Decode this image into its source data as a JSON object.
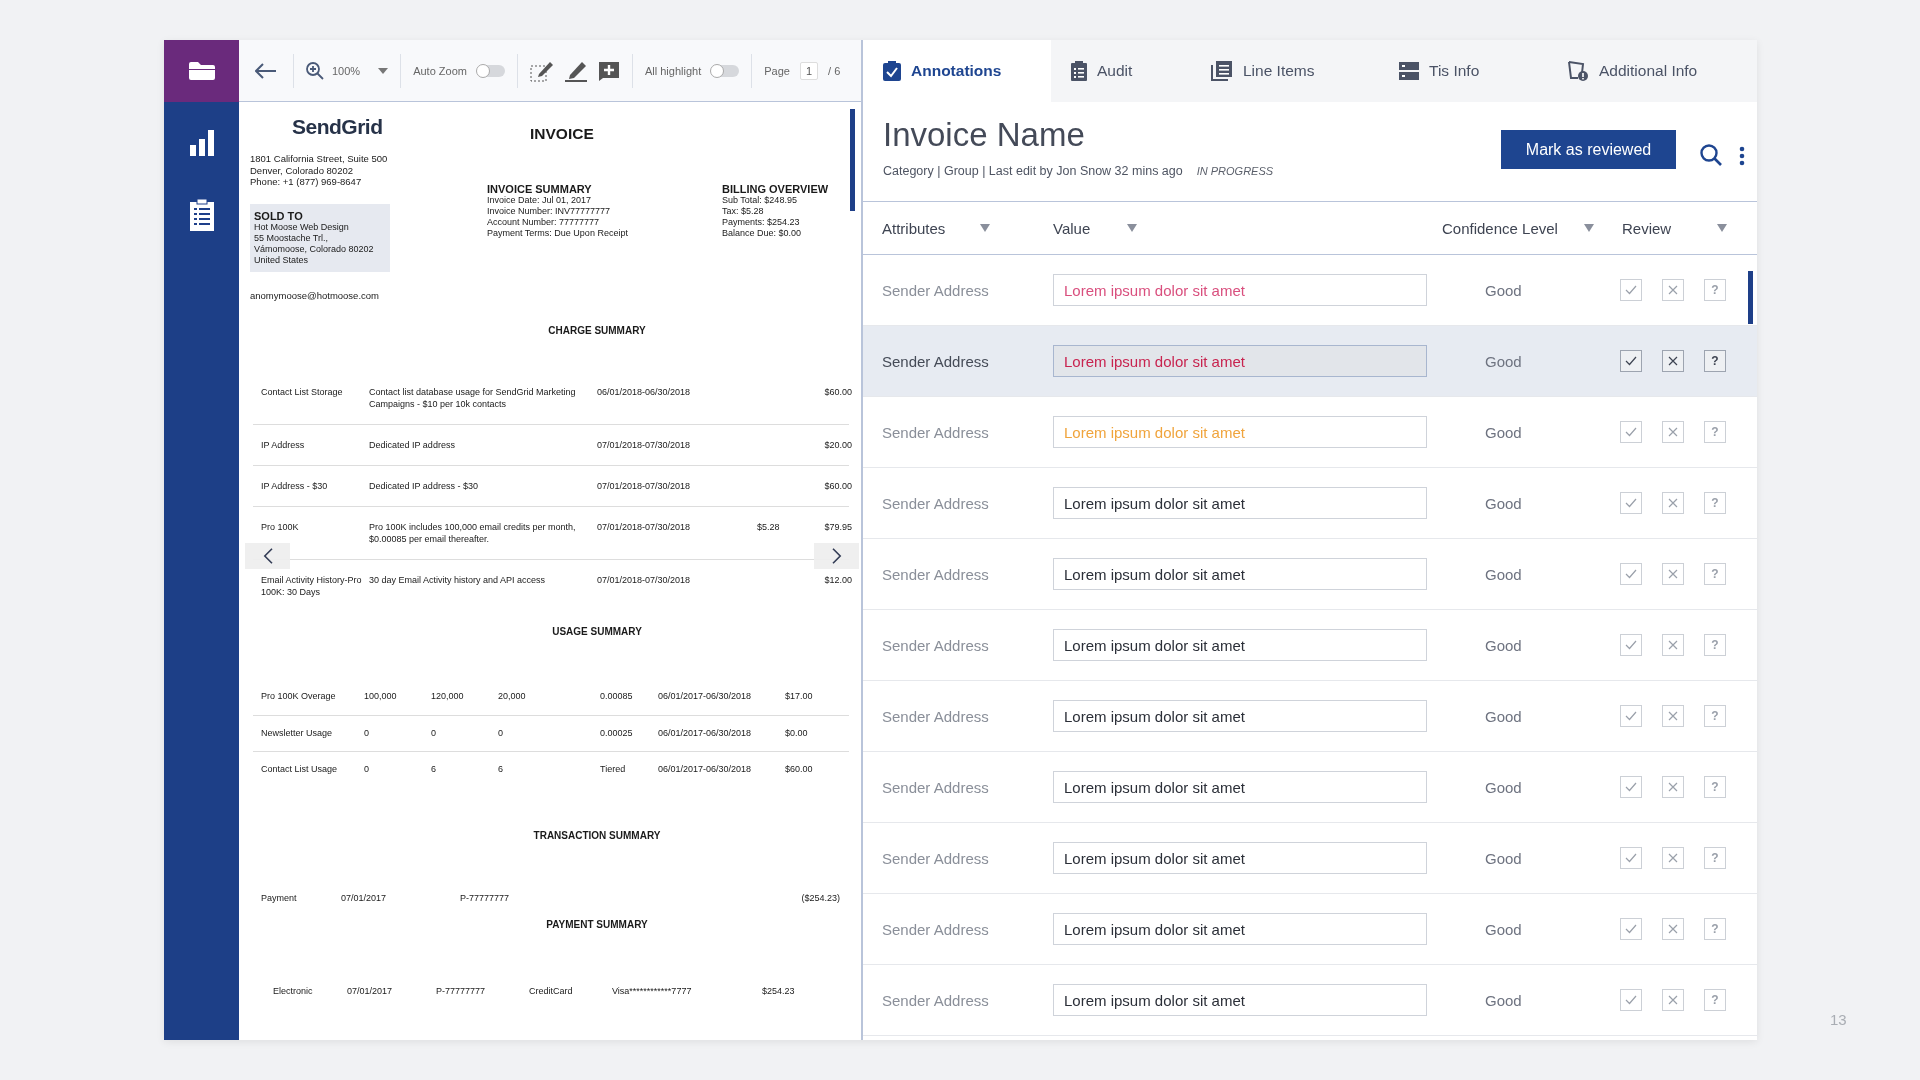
{
  "sidebar": {
    "items": [
      {
        "selected": true
      },
      {
        "selected": false
      },
      {
        "selected": false
      }
    ]
  },
  "toolbar": {
    "zoom": "100%",
    "auto_zoom": {
      "label": "Auto Zoom",
      "on": false
    },
    "all_highlight": {
      "label": "All highlight",
      "on": false
    },
    "page": {
      "label": "Page",
      "value": "1",
      "total": "/ 6"
    }
  },
  "document": {
    "logo": "SendGrid",
    "title": "INVOICE",
    "address": [
      "1801 California Street, Suite 500",
      "Denver, Colorado 80202",
      "Phone: +1 (877) 969-8647"
    ],
    "sold_to": {
      "heading": "SOLD TO",
      "lines": [
        "Hot Moose Web Design",
        "55 Moostache Trl.,",
        "Vámomoose, Colorado 80202",
        "United States"
      ]
    },
    "email": "anomymoose@hotmoose.com",
    "invoice_summary": {
      "heading": "INVOICE SUMMARY",
      "lines": [
        "Invoice Date: Jul 01, 2017",
        "Invoice Number: INV77777777",
        "Account Number: 77777777",
        "Payment Terms: Due Upon Receipt"
      ]
    },
    "billing_overview": {
      "heading": "BILLING OVERVIEW",
      "lines": [
        "Sub Total: $248.95",
        "Tax: $5.28",
        "Payments: $254.23",
        "Balance Due: $0.00"
      ]
    },
    "charge_summary": {
      "heading": "CHARGE SUMMARY",
      "rows": [
        {
          "item": "Contact List Storage",
          "description": "Contact list database usage for SendGrid Marketing Campaigns - $10 per 10k contacts",
          "period": "06/01/2018-06/30/2018",
          "amount": "$60.00"
        },
        {
          "item": "IP Address",
          "description": "Dedicated IP address",
          "period": "07/01/2018-07/30/2018",
          "amount": "$20.00"
        },
        {
          "item": "IP Address - $30",
          "description": "Dedicated IP address  - $30",
          "period": "07/01/2018-07/30/2018",
          "amount": "$60.00"
        },
        {
          "item": "Pro 100K",
          "description": "Pro 100K includes 100,000 email credits per month, $0.00085 per email thereafter.",
          "period": "07/01/2018-07/30/2018",
          "tax": "$5.28",
          "amount": "$79.95"
        },
        {
          "item": "Email Activity History-Pro 100K: 30 Days",
          "description": "30 day Email Activity history and API access",
          "period": "07/01/2018-07/30/2018",
          "amount": "$12.00"
        }
      ]
    },
    "usage_summary": {
      "heading": "USAGE SUMMARY",
      "rows": [
        [
          "Pro 100K Overage",
          "100,000",
          "120,000",
          "20,000",
          "0.00085",
          "06/01/2017-06/30/2018",
          "$17.00"
        ],
        [
          "Newsletter Usage",
          "0",
          "0",
          "0",
          "0.00025",
          "06/01/2017-06/30/2018",
          "$0.00"
        ],
        [
          "Contact List Usage",
          "0",
          "6",
          "6",
          "Tiered",
          "06/01/2017-06/30/2018",
          "$60.00"
        ]
      ]
    },
    "transaction_summary": {
      "heading": "TRANSACTION SUMMARY",
      "rows": [
        [
          "Payment",
          "07/01/2017",
          "P-77777777",
          "($254.23)"
        ]
      ]
    },
    "payment_summary": {
      "heading": "PAYMENT SUMMARY",
      "rows": [
        [
          "Electronic",
          "07/01/2017",
          "P-77777777",
          "CreditCard",
          "Visa************7777",
          "$254.23"
        ]
      ]
    }
  },
  "tabs": [
    {
      "label": "Annotations",
      "selected": true
    },
    {
      "label": "Audit",
      "selected": false
    },
    {
      "label": "Line Items",
      "selected": false
    },
    {
      "label": "Tis Info",
      "selected": false
    },
    {
      "label": "Additional Info",
      "selected": false
    }
  ],
  "header": {
    "title": "Invoice Name",
    "meta": "Category | Group | Last edit by Jon Snow 32 mins ago",
    "status": "IN PROGRESS",
    "button": "Mark as reviewed"
  },
  "columns": [
    "Attributes",
    "Value",
    "Confidence Level",
    "Review"
  ],
  "rows": [
    {
      "attribute": "Sender Address",
      "value": "Lorem ipsum dolor sit amet",
      "color": "#d94f7e",
      "confidence": "Good",
      "help": "?",
      "selected": false
    },
    {
      "attribute": "Sender Address",
      "value": "Lorem ipsum dolor sit amet",
      "color": "#c8234f",
      "confidence": "Good",
      "help": "?",
      "selected": true
    },
    {
      "attribute": "Sender Address",
      "value": "Lorem ipsum dolor sit amet",
      "color": "#f0a43c",
      "confidence": "Good",
      "help": "?",
      "selected": false
    },
    {
      "attribute": "Sender Address",
      "value": "Lorem ipsum dolor sit amet",
      "color": "#2b2f38",
      "confidence": "Good",
      "help": "?",
      "selected": false
    },
    {
      "attribute": "Sender Address",
      "value": "Lorem ipsum dolor sit amet",
      "color": "#2b2f38",
      "confidence": "Good",
      "help": "?",
      "selected": false
    },
    {
      "attribute": "Sender Address",
      "value": "Lorem ipsum dolor sit amet",
      "color": "#2b2f38",
      "confidence": "Good",
      "help": "?",
      "selected": false
    },
    {
      "attribute": "Sender Address",
      "value": "Lorem ipsum dolor sit amet",
      "color": "#2b2f38",
      "confidence": "Good",
      "help": "?",
      "selected": false
    },
    {
      "attribute": "Sender Address",
      "value": "Lorem ipsum dolor sit amet",
      "color": "#2b2f38",
      "confidence": "Good",
      "help": "?",
      "selected": false
    },
    {
      "attribute": "Sender Address",
      "value": "Lorem ipsum dolor sit amet",
      "color": "#2b2f38",
      "confidence": "Good",
      "help": "?",
      "selected": false
    },
    {
      "attribute": "Sender Address",
      "value": "Lorem ipsum dolor sit amet",
      "color": "#2b2f38",
      "confidence": "Good",
      "help": "?",
      "selected": false
    },
    {
      "attribute": "Sender Address",
      "value": "Lorem ipsum dolor sit amet",
      "color": "#2b2f38",
      "confidence": "Good",
      "help": "?",
      "selected": false
    }
  ],
  "page_number": "13"
}
